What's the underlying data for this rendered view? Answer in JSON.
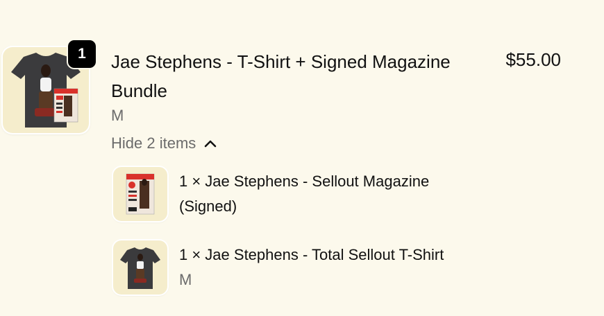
{
  "bundle": {
    "quantity_badge": "1",
    "title": "Jae Stephens - T-Shirt + Signed Magazine Bundle",
    "price": "$55.00",
    "variant": "M",
    "toggle_label": "Hide 2 items",
    "image_icon": "tshirt-magazine-bundle-image"
  },
  "items": [
    {
      "title": "1 × Jae Stephens - Sellout Magazine (Signed)",
      "variant": "",
      "image_icon": "magazine-cover-image"
    },
    {
      "title": "1 × Jae Stephens - Total Sellout T-Shirt",
      "variant": "M",
      "image_icon": "tshirt-image"
    }
  ],
  "colors": {
    "background": "#fcf9ec",
    "thumb_background": "#f5edcc",
    "badge": "#000000",
    "secondary_text": "#6b6b6b",
    "shirt": "#3b3b3d",
    "magazine_accent": "#d9312b"
  }
}
